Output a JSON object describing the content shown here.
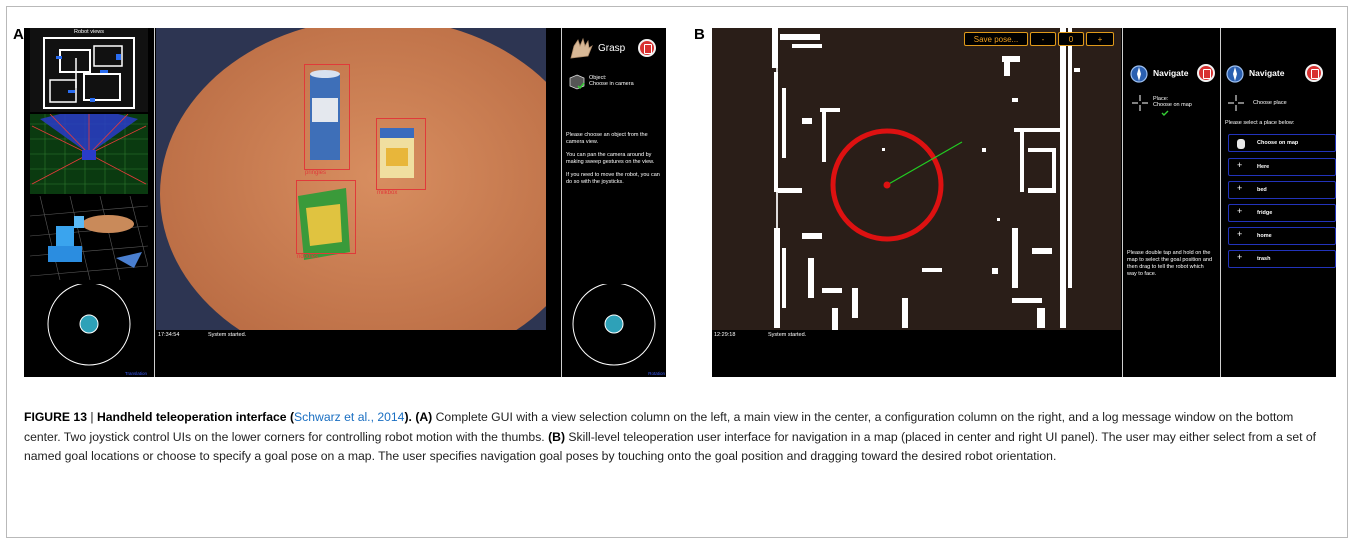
{
  "panel_a": {
    "letter": "A",
    "view_column": {
      "title": "Robot views"
    },
    "main_view": {
      "objects": [
        {
          "label": "pringles"
        },
        {
          "label": "milkbox"
        },
        {
          "label": "noodles"
        }
      ],
      "log_time": "17:34:54",
      "log_message": "System started."
    },
    "config": {
      "skill_title": "Grasp",
      "param_label": "Object:",
      "param_value": "Choose in camera",
      "help_1": "Please choose an object from the camera view.",
      "help_2": "You can pan the camera around by making sweep gestures on the view.",
      "help_3": "If you need to move the robot, you can do so with the joysticks."
    },
    "joystick_left_label": "Translation",
    "joystick_right_label": "Rotation"
  },
  "panel_b": {
    "letter": "B",
    "toolbar": {
      "save_label": "Save pose...",
      "minus_label": "-",
      "count": "0",
      "plus_label": "+"
    },
    "log_time": "12:29:18",
    "log_message": "System started.",
    "mid_panel": {
      "skill_title": "Navigate",
      "place_label": "Place:",
      "place_value": "Choose on map",
      "help": "Please double tap and hold on the map to select the goal position and then drag to tell the robot which way to face."
    },
    "right_panel": {
      "skill_title": "Navigate",
      "choose_label": "Choose place",
      "select_prompt": "Please select a place below:",
      "places": [
        "Choose on map",
        "Here",
        "bed",
        "fridge",
        "home",
        "trash"
      ]
    }
  },
  "caption": {
    "figure_label": "FIGURE 13",
    "separator": " | ",
    "title": "Handheld teleoperation interface (",
    "citation": "Schwarz et al., 2014",
    "title_end": "). ",
    "a_label": "(A)",
    "a_text": " Complete GUI with a view selection column on the left, a main view in the center, a configuration column on the right, and a log message window on the bottom center. Two joystick control UIs on the lower corners for controlling robot motion with the thumbs. ",
    "b_label": "(B)",
    "b_text": " Skill-level teleoperation user interface for navigation in a map (placed in center and right UI panel). The user may either select from a set of named goal locations or choose to specify a goal pose on a map. The user specifies navigation goal poses by touching onto the goal position and dragging toward the desired robot orientation."
  },
  "colors": {
    "object_box": "#e03a3a",
    "goal_circle": "#dd1111",
    "goal_heading": "#22cc22",
    "place_button_border": "#2233bb",
    "toolbar_orange": "#e09a1a"
  }
}
